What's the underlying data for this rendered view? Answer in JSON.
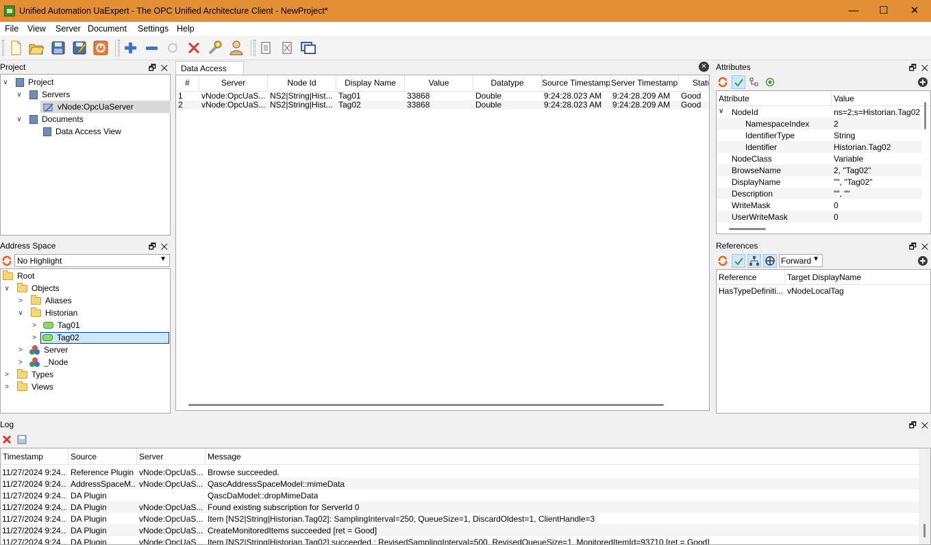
{
  "window": {
    "title": "Unified Automation UaExpert - The OPC Unified Architecture Client - NewProject*",
    "minimize": "—",
    "maximize": "☐",
    "close": "✕"
  },
  "menu": [
    "File",
    "View",
    "Server",
    "Document",
    "Settings",
    "Help"
  ],
  "toolbar": {
    "icons": [
      "new-project-icon",
      "open-project-icon",
      "save-project-icon",
      "save-as-icon",
      "quit-icon",
      "add-server-icon",
      "remove-server-icon",
      "reconnect-icon",
      "disconnect-icon",
      "settings-icon",
      "user-icon",
      "add-document-icon",
      "remove-document-icon",
      "windows-icon"
    ]
  },
  "project": {
    "title": "Project",
    "tree": [
      {
        "label": "Project",
        "level": 0,
        "expanded": true
      },
      {
        "label": "Servers",
        "level": 1,
        "expanded": true
      },
      {
        "label": "vNode:OpcUaServer",
        "level": 2,
        "selected": true
      },
      {
        "label": "Documents",
        "level": 1,
        "expanded": true
      },
      {
        "label": "Data Access View",
        "level": 2
      }
    ]
  },
  "address_space": {
    "title": "Address Space",
    "highlight": "No Highlight",
    "tree": [
      {
        "label": "Root",
        "level": 0
      },
      {
        "label": "Objects",
        "level": 1,
        "expanded": true
      },
      {
        "label": "Aliases",
        "level": 2
      },
      {
        "label": "Historian",
        "level": 2,
        "expanded": true
      },
      {
        "label": "Tag01",
        "level": 3
      },
      {
        "label": "Tag02",
        "level": 3,
        "selected": true
      },
      {
        "label": "Server",
        "level": 2
      },
      {
        "label": "_Node",
        "level": 2
      },
      {
        "label": "Types",
        "level": 1
      },
      {
        "label": "Views",
        "level": 1
      }
    ]
  },
  "data_access": {
    "tab": "Data Access View",
    "columns": [
      "#",
      "Server",
      "Node Id",
      "Display Name",
      "Value",
      "Datatype",
      "Source Timestamp",
      "Server Timestamp",
      "Status"
    ],
    "rows": [
      [
        "1",
        "vNode:OpcUaS...",
        "NS2|String|Hist...",
        "Tag01",
        "33868",
        "Double",
        "9:24:28.023 AM",
        "9:24:28.209 AM",
        "Good"
      ],
      [
        "2",
        "vNode:OpcUaS...",
        "NS2|String|Hist...",
        "Tag02",
        "33868",
        "Double",
        "9:24:28.023 AM",
        "9:24:28.209 AM",
        "Good"
      ]
    ]
  },
  "attributes": {
    "title": "Attributes",
    "columns": [
      "Attribute",
      "Value"
    ],
    "rows": [
      [
        "NodeId",
        "ns=2;s=Historian.Tag02"
      ],
      [
        "NamespaceIndex",
        "2"
      ],
      [
        "IdentifierType",
        "String"
      ],
      [
        "Identifier",
        "Historian.Tag02"
      ],
      [
        "NodeClass",
        "Variable"
      ],
      [
        "BrowseName",
        "2, \"Tag02\""
      ],
      [
        "DisplayName",
        "\"\", \"Tag02\""
      ],
      [
        "Description",
        "\"\", \"\""
      ],
      [
        "WriteMask",
        "0"
      ],
      [
        "UserWriteMask",
        "0"
      ]
    ]
  },
  "references": {
    "title": "References",
    "direction": "Forward",
    "columns": [
      "Reference",
      "Target DisplayName"
    ],
    "rows": [
      [
        "HasTypeDefiniti...",
        "vNodeLocalTag"
      ]
    ]
  },
  "log": {
    "title": "Log",
    "columns": [
      "Timestamp",
      "Source",
      "Server",
      "Message"
    ],
    "rows": [
      [
        "11/27/2024 9:24...",
        "Reference Plugin",
        "vNode:OpcUaS...",
        "Browse succeeded."
      ],
      [
        "11/27/2024 9:24...",
        "AddressSpaceM...",
        "vNode:OpcUaS...",
        "QascAddressSpaceModel::mimeData"
      ],
      [
        "11/27/2024 9:24...",
        "DA Plugin",
        "",
        "QascDaModel::dropMimeData"
      ],
      [
        "11/27/2024 9:24...",
        "DA Plugin",
        "vNode:OpcUaS...",
        "Found existing subscription for ServerId 0"
      ],
      [
        "11/27/2024 9:24...",
        "DA Plugin",
        "vNode:OpcUaS...",
        "Item [NS2|String|Historian.Tag02]: SamplingInterval=250, QueueSize=1, DiscardOldest=1, ClientHandle=3"
      ],
      [
        "11/27/2024 9:24...",
        "DA Plugin",
        "vNode:OpcUaS...",
        "CreateMonitoredItems succeeded [ret = Good]"
      ],
      [
        "11/27/2024 9:24...",
        "DA Plugin",
        "vNode:OpcUaS...",
        "Item [NS2|String|Historian.Tag02] succeeded : RevisedSamplingInterval=500, RevisedQueueSize=1, MonitoredItemId=93710 [ret = Good]"
      ]
    ]
  },
  "colors": {
    "titlebar": "#e38f36",
    "selection": "#cce8ff",
    "selection_inactive": "#d9d9d9"
  }
}
